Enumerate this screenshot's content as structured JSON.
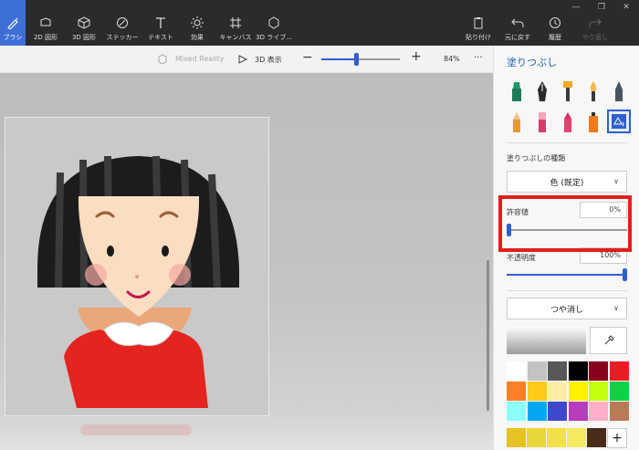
{
  "toolbar": {
    "tools": [
      {
        "label": "ブラシ",
        "icon": "brush-icon",
        "active": true
      },
      {
        "label": "2D 図形",
        "icon": "2d-shapes-icon",
        "active": false
      },
      {
        "label": "3D 図形",
        "icon": "3d-shapes-icon",
        "active": false
      },
      {
        "label": "ステッカー",
        "icon": "sticker-icon",
        "active": false
      },
      {
        "label": "テキスト",
        "icon": "text-icon",
        "active": false
      },
      {
        "label": "効果",
        "icon": "effects-icon",
        "active": false
      },
      {
        "label": "キャンバス",
        "icon": "canvas-icon",
        "active": false
      },
      {
        "label": "3D ライブ...",
        "icon": "3d-library-icon",
        "active": false
      }
    ],
    "paste_label": "貼り付け",
    "undo_label": "元に戻す",
    "history_label": "履歴",
    "redo_label": "やり直し"
  },
  "subbar": {
    "mixed_reality": "Mixed Reality",
    "view_3d": "3D 表示",
    "zoom": "84%",
    "zoom_level": 0.44,
    "more": "···"
  },
  "panel": {
    "title": "塗りつぶし",
    "fill_type_label": "塗りつぶしの種類",
    "fill_type_value": "色 (既定)",
    "tolerance_label": "許容値",
    "tolerance_value": "0%",
    "tolerance_level": 0,
    "opacity_label": "不透明度",
    "opacity_value": "100%",
    "opacity_level": 1,
    "finish_value": "つや消し",
    "add_color": "+"
  },
  "colors": {
    "accent": "#3d6fd6",
    "highlight": "#e0201b",
    "palette": [
      "#ffffff",
      "#c3c3c3",
      "#585858",
      "#000000",
      "#88001b",
      "#ec1c24",
      "#ff7f27",
      "#ffca18",
      "#fdeca6",
      "#fff200",
      "#c4ff0e",
      "#0ed145",
      "#8cfffb",
      "#00a8f3",
      "#3f48cc",
      "#b83dba",
      "#ffaec8",
      "#b97a56"
    ],
    "custom": [
      "#e5c324",
      "#e9d63a",
      "#f2e04a",
      "#f3ea5f",
      "#4a2a1b"
    ]
  }
}
